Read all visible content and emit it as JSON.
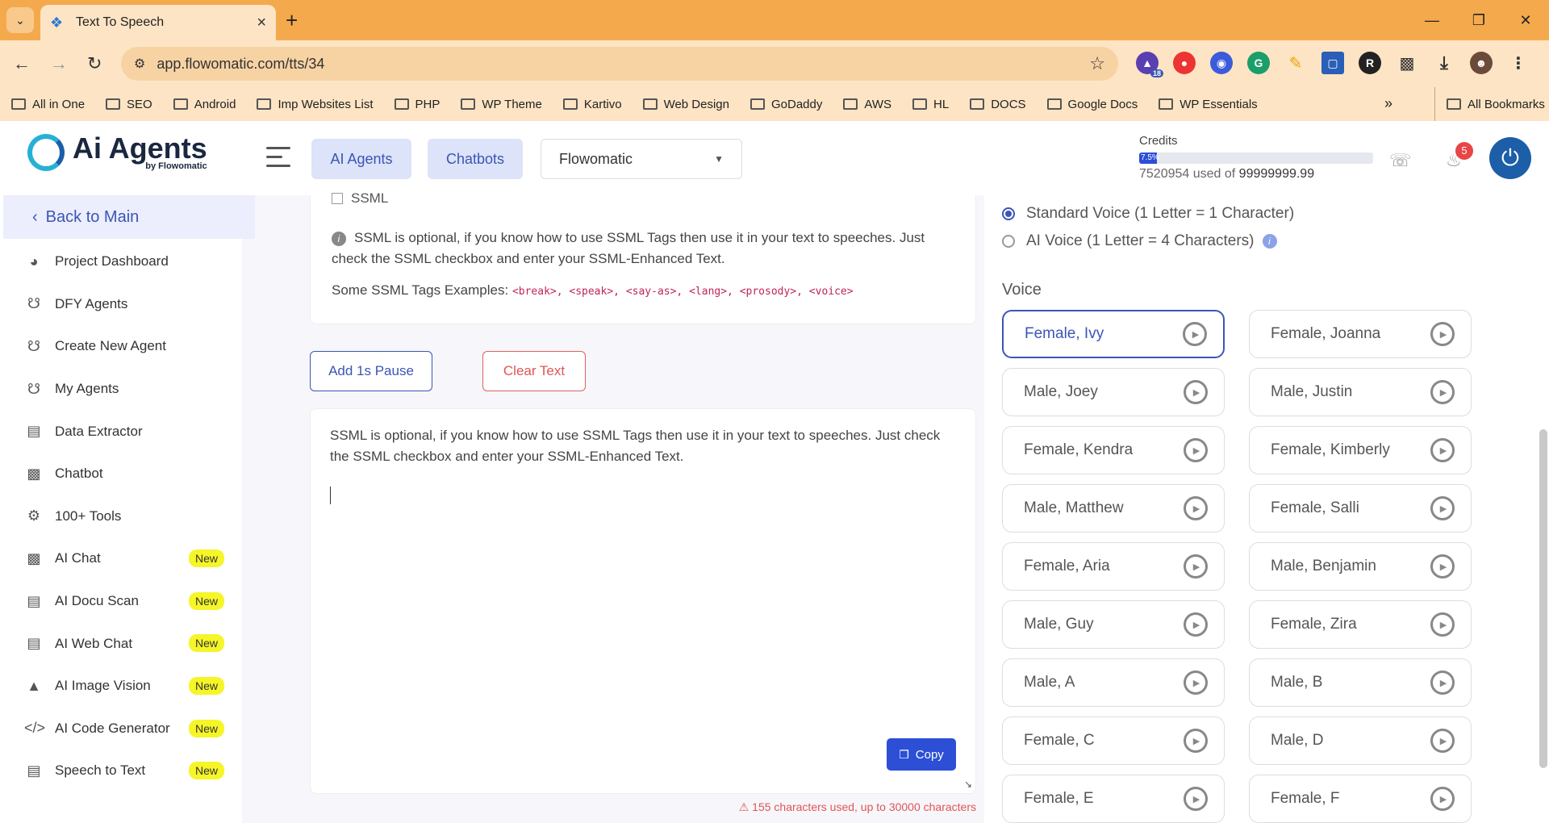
{
  "browser": {
    "tab_title": "Text To Speech",
    "url": "app.flowomatic.com/tts/34",
    "ext_badge": "18",
    "bookmarks": [
      "All in One",
      "SEO",
      "Android",
      "Imp Websites List",
      "PHP",
      "WP Theme",
      "Kartivo",
      "Web Design",
      "GoDaddy",
      "AWS",
      "HL",
      "DOCS",
      "Google Docs",
      "WP Essentials"
    ],
    "all_bookmarks": "All Bookmarks",
    "colors": {
      "tabbar": "#f5a94d",
      "toolbar": "#fde4c4"
    }
  },
  "header": {
    "logo_title": "Ai Agents",
    "logo_sub": "by Flowomatic",
    "btn_agents": "AI Agents",
    "btn_chatbots": "Chatbots",
    "workspace": "Flowomatic",
    "credits_label": "Credits",
    "credits_percent_label": "7.5%",
    "credits_fraction": 0.075,
    "credits_used": "7520954 used of ",
    "credits_total": "99999999.99",
    "notif_count": "5"
  },
  "sidebar": {
    "back": "Back to Main",
    "items": [
      {
        "label": "Project Dashboard",
        "icon": "dashboard-icon",
        "new": false
      },
      {
        "label": "DFY Agents",
        "icon": "agents-icon",
        "new": false
      },
      {
        "label": "Create New Agent",
        "icon": "agents-icon",
        "new": false
      },
      {
        "label": "My Agents",
        "icon": "agents-icon",
        "new": false
      },
      {
        "label": "Data Extractor",
        "icon": "document-icon",
        "new": false
      },
      {
        "label": "Chatbot",
        "icon": "robot-icon",
        "new": false
      },
      {
        "label": "100+ Tools",
        "icon": "tools-icon",
        "new": false
      },
      {
        "label": "AI Chat",
        "icon": "robot-icon",
        "new": true
      },
      {
        "label": "AI Docu Scan",
        "icon": "document-icon",
        "new": true
      },
      {
        "label": "AI Web Chat",
        "icon": "document-icon",
        "new": true
      },
      {
        "label": "AI Image Vision",
        "icon": "vision-icon",
        "new": true
      },
      {
        "label": "AI Code Generator",
        "icon": "code-icon",
        "new": true
      },
      {
        "label": "Speech to Text",
        "icon": "mic-icon",
        "new": true
      }
    ],
    "new_label": "New"
  },
  "main": {
    "ssml_label": "SSML",
    "info_text": "SSML is optional, if you know how to use SSML Tags then use it in your text to speeches. Just check the SSML checkbox and enter your SSML-Enhanced Text.",
    "tags_label": "Some SSML Tags Examples: ",
    "tags": "<break>, <speak>, <say-as>, <lang>, <prosody>, <voice>",
    "add_pause": "Add 1s Pause",
    "clear_text": "Clear Text",
    "editor_text": " SSML is optional, if you know how to use SSML Tags then use it in your text to speeches. Just check the SSML checkbox and enter your SSML-Enhanced Text.",
    "copy": "Copy",
    "char_count": "155 characters used, up to 30000 characters"
  },
  "voice_panel": {
    "standard": "Standard Voice (1 Letter = 1 Character)",
    "ai": "AI Voice (1 Letter = 4 Characters)",
    "heading": "Voice",
    "voices": [
      "Female, Ivy",
      "Female, Joanna",
      "Male, Joey",
      "Male, Justin",
      "Female, Kendra",
      "Female, Kimberly",
      "Male, Matthew",
      "Female, Salli",
      "Female, Aria",
      "Male, Benjamin",
      "Male, Guy",
      "Female, Zira",
      "Male, A",
      "Male, B",
      "Female, C",
      "Male, D",
      "Female, E",
      "Female, F"
    ],
    "selected": "Female, Ivy"
  }
}
